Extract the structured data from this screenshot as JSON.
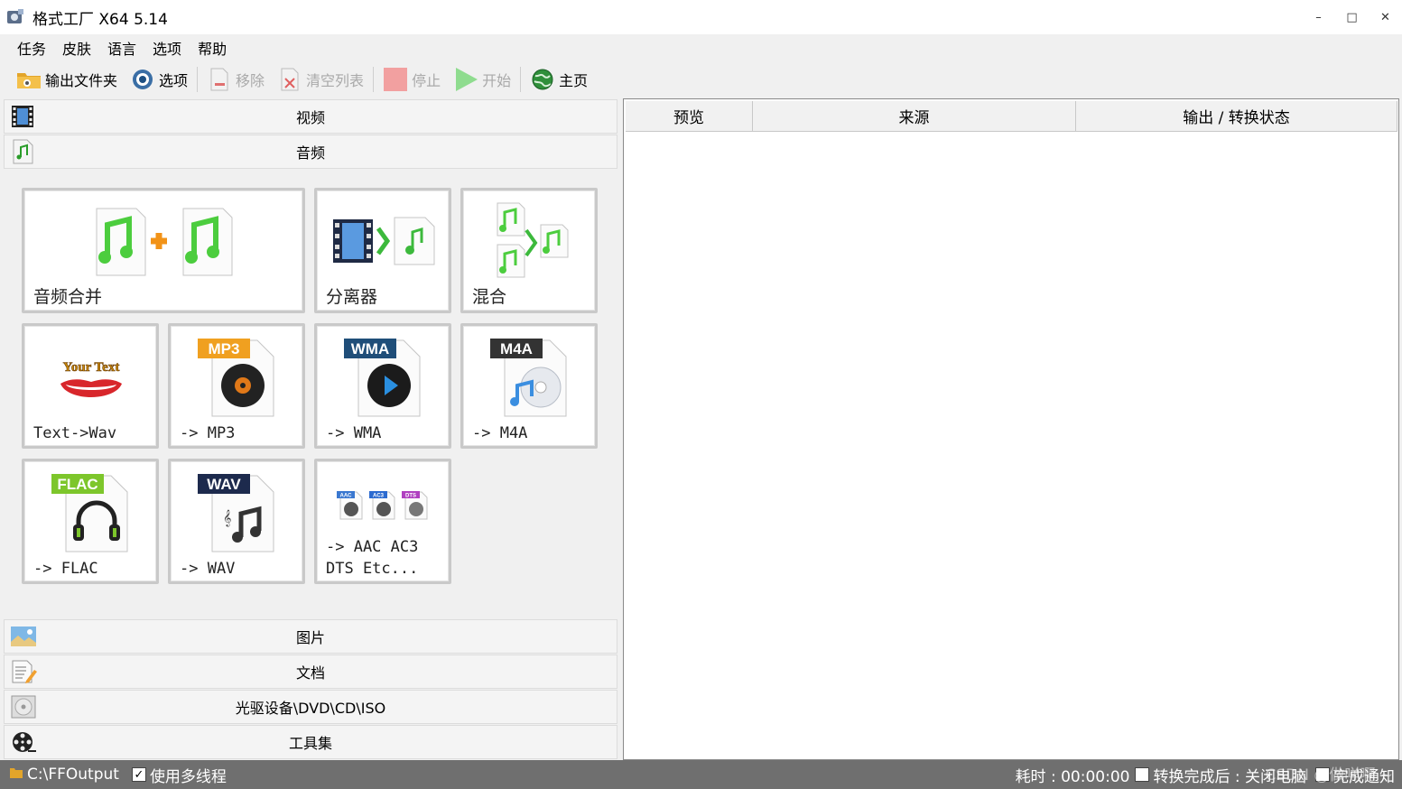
{
  "window": {
    "title": "格式工厂 X64 5.14",
    "minimize": "–",
    "maximize": "□",
    "close": "✕"
  },
  "menu": [
    "任务",
    "皮肤",
    "语言",
    "选项",
    "帮助"
  ],
  "toolbar": {
    "output_folder": "输出文件夹",
    "options": "选项",
    "remove": "移除",
    "clear_list": "清空列表",
    "stop": "停止",
    "start": "开始",
    "home": "主页"
  },
  "categories": {
    "video": "视频",
    "audio": "音频",
    "image": "图片",
    "document": "文档",
    "disc": "光驱设备\\DVD\\CD\\ISO",
    "tools": "工具集"
  },
  "audio_tiles": {
    "merge": "音频合并",
    "splitter": "分离器",
    "mix": "混合",
    "text_wav": "Text->Wav",
    "mp3": "-> MP3",
    "wma": "-> WMA",
    "m4a": "-> M4A",
    "flac": "-> FLAC",
    "wav": "-> WAV",
    "other_line1": "-> AAC AC3",
    "other_line2": "DTS Etc...",
    "your_text": "Your Text",
    "badge_mp3": "MP3",
    "badge_wma": "WMA",
    "badge_m4a": "M4A",
    "badge_flac": "FLAC",
    "badge_wav": "WAV",
    "badge_aac": "AAC",
    "badge_ac3": "AC3",
    "badge_dts": "DTS"
  },
  "table": {
    "columns": [
      "预览",
      "来源",
      "输出 / 转换状态"
    ]
  },
  "status": {
    "output_path": "C:\\FFOutput",
    "multithread_label": "使用多线程",
    "multithread_checked": true,
    "elapsed": "耗时 : 00:00:00",
    "after_done": "转换完成后 : 关闭电脑",
    "notify": "完成通知",
    "watermark": "CSDN @做咩啊 ~"
  },
  "colors": {
    "accent_green": "#3cb93c",
    "statusbar": "#6f6f6f",
    "mp3_badge": "#f0a020",
    "wma_badge": "#1f4e79",
    "m4a_badge": "#333333",
    "flac_badge": "#7dc62b",
    "wav_badge": "#1d2a4d"
  }
}
